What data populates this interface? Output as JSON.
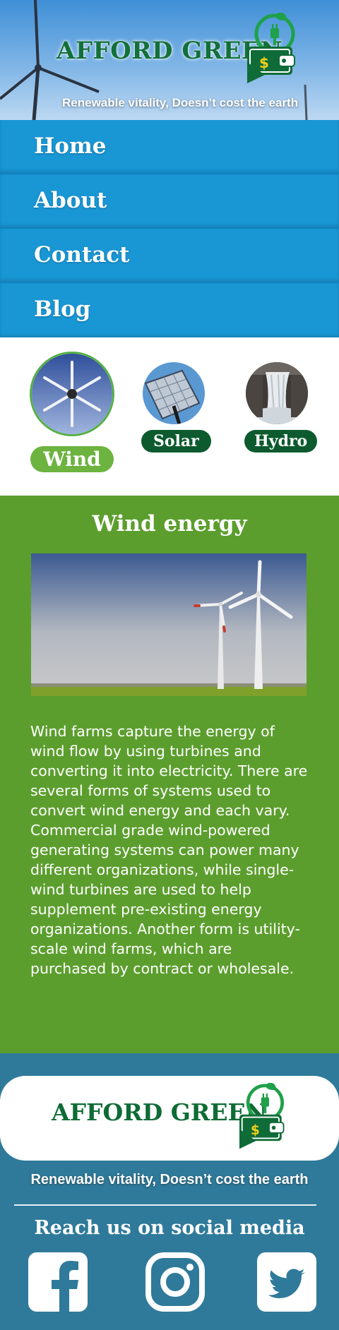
{
  "header": {
    "brand": "AFFORD GREEN",
    "tagline": "Renewable vitality, Doesn’t cost the earth"
  },
  "nav": {
    "items": [
      {
        "label": "Home"
      },
      {
        "label": "About"
      },
      {
        "label": "Contact"
      },
      {
        "label": "Blog"
      }
    ]
  },
  "energy_types": [
    {
      "label": "Wind",
      "selected": true
    },
    {
      "label": "Solar",
      "selected": false
    },
    {
      "label": "Hydro",
      "selected": false
    }
  ],
  "content": {
    "title": "Wind energy",
    "body": "Wind farms capture the energy of wind flow by using turbines and converting it into electricity. There are several forms of systems used to convert wind energy and each vary. Commercial grade wind-powered generating systems can power many different organizations, while single-wind turbines are used to help supplement pre-existing energy organizations. Another form is utility-scale wind farms, which are purchased by contract or wholesale."
  },
  "footer": {
    "brand": "AFFORD GREEN",
    "tagline": "Renewable vitality, Doesn’t cost the earth",
    "social_title": "Reach us on social media",
    "social": [
      {
        "icon": "facebook-icon"
      },
      {
        "icon": "instagram-icon"
      },
      {
        "icon": "twitter-icon"
      }
    ]
  },
  "colors": {
    "header_sky": "#3f8fd6",
    "brand_green": "#12703a",
    "nav_blue": "#1996d4",
    "content_green": "#5c9e2e",
    "selected_pill": "#6cb33f",
    "pill_dark": "#0c5a2e",
    "footer_blue": "#2f7a9a"
  }
}
